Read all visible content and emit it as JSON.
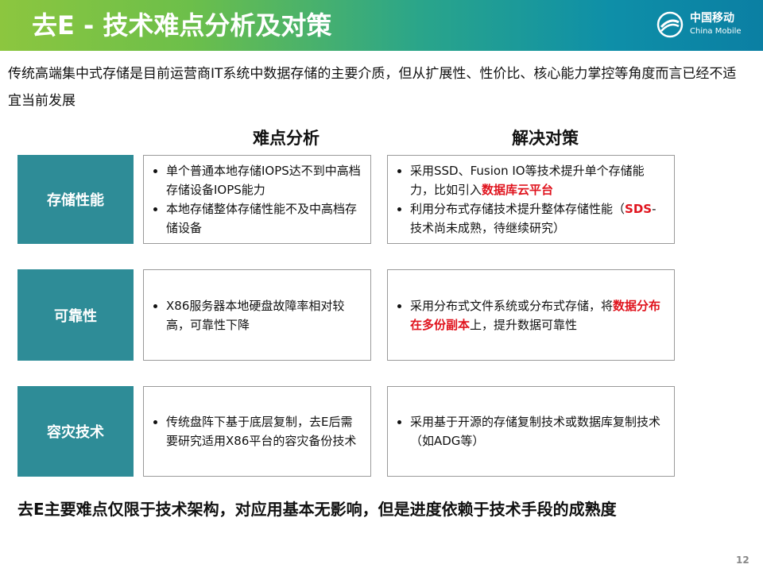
{
  "header": {
    "title": "去E - 技术难点分析及对策",
    "logo_cn": "中国移动",
    "logo_en": "China Mobile"
  },
  "intro": "传统高端集中式存储是目前运营商IT系统中数据存储的主要介质，但从扩展性、性价比、核心能力掌控等角度而言已经不适宜当前发展",
  "columns": {
    "analysis": "难点分析",
    "solution": "解决对策"
  },
  "rows": [
    {
      "label": "存储性能",
      "analysis": [
        "单个普通本地存储IOPS达不到中高档存储设备IOPS能力",
        "本地存储整体存储性能不及中高档存储设备"
      ],
      "solution": [
        {
          "before": "采用SSD、Fusion IO等技术提升单个存储能力，比如引入",
          "highlight": "数据库云平台",
          "after": ""
        },
        {
          "before": "利用分布式存储技术提升整体存储性能（",
          "highlight": "SDS",
          "after": "- 技术尚未成熟，待继续研究）"
        }
      ]
    },
    {
      "label": "可靠性",
      "analysis": [
        "X86服务器本地硬盘故障率相对较高，可靠性下降"
      ],
      "solution": [
        {
          "before": "采用分布式文件系统或分布式存储，将",
          "highlight": "数据分布在多份副本",
          "after": "上，提升数据可靠性"
        }
      ]
    },
    {
      "label": "容灾技术",
      "analysis": [
        "传统盘阵下基于底层复制，去E后需要研究适用X86平台的容灾备份技术"
      ],
      "solution": [
        {
          "before": "采用基于开源的存储复制技术或数据库复制技术（如ADG等）",
          "highlight": "",
          "after": ""
        }
      ]
    }
  ],
  "footer": "去E主要难点仅限于技术架构，对应用基本无影响，但是进度依赖于技术手段的成熟度",
  "page_number": "12",
  "colors": {
    "banner_start": "#8cc63f",
    "banner_end": "#0b7fa3",
    "label_bg": "#2e8c97",
    "highlight": "#e0141e"
  }
}
